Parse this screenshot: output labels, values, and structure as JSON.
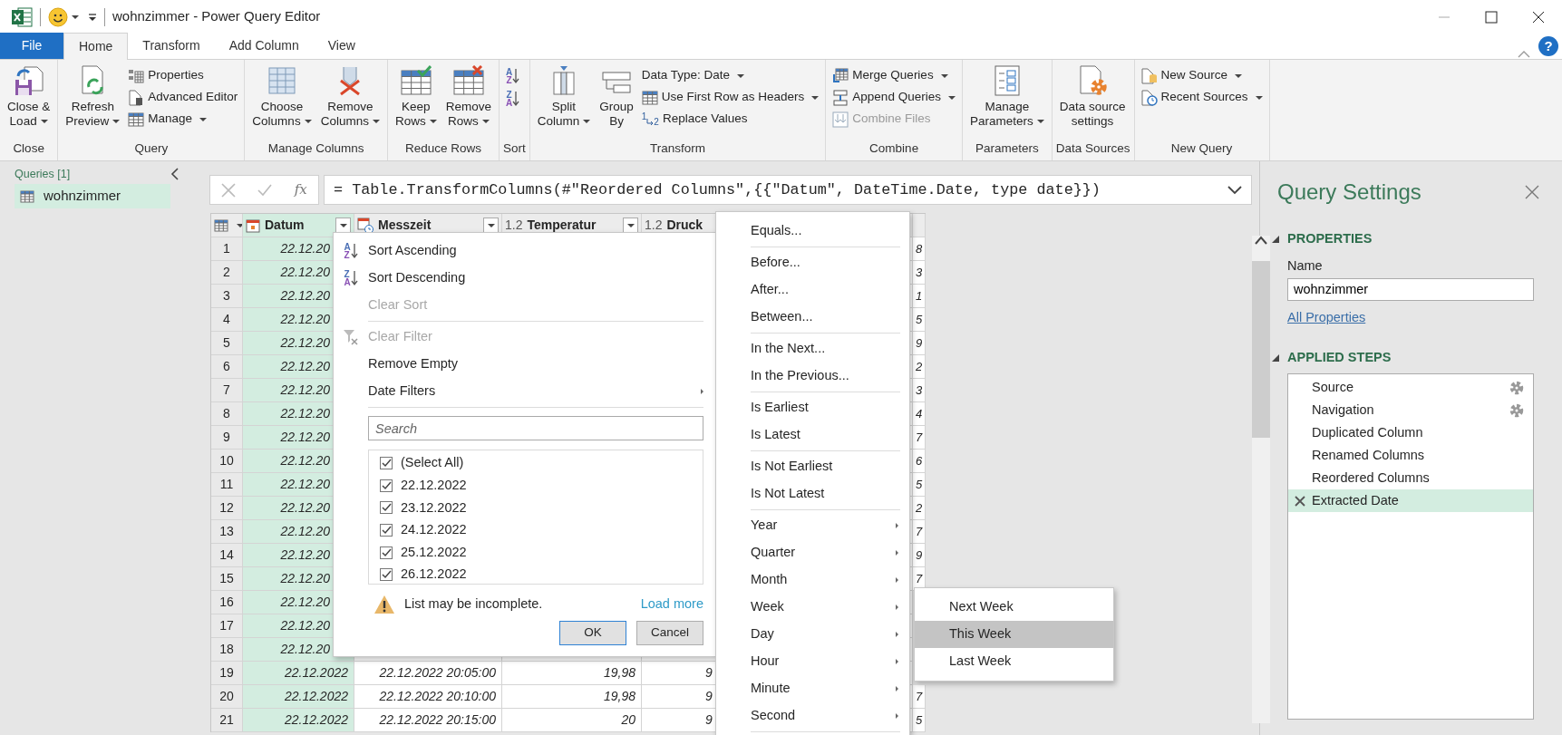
{
  "window": {
    "title": "wohnzimmer - Power Query Editor"
  },
  "help_label": "?",
  "ribbon_tabs": [
    {
      "label": "File",
      "kind": "file",
      "selected": false
    },
    {
      "label": "Home",
      "kind": "tab",
      "selected": true
    },
    {
      "label": "Transform",
      "kind": "tab",
      "selected": false
    },
    {
      "label": "Add Column",
      "kind": "tab",
      "selected": false
    },
    {
      "label": "View",
      "kind": "tab",
      "selected": false
    }
  ],
  "ribbon_groups": [
    {
      "label": "Close",
      "items": [
        {
          "kind": "large",
          "lines": [
            "Close &",
            "Load"
          ],
          "dropdown": true
        }
      ]
    },
    {
      "label": "Query",
      "items": [
        {
          "kind": "large",
          "lines": [
            "Refresh",
            "Preview"
          ],
          "dropdown": true
        },
        {
          "kind": "small",
          "label": "Properties"
        },
        {
          "kind": "small",
          "label": "Advanced Editor"
        },
        {
          "kind": "small",
          "label": "Manage",
          "dropdown": true
        }
      ]
    },
    {
      "label": "Manage Columns",
      "items": [
        {
          "kind": "large",
          "lines": [
            "Choose",
            "Columns"
          ],
          "dropdown": true
        },
        {
          "kind": "large",
          "lines": [
            "Remove",
            "Columns"
          ],
          "dropdown": true
        }
      ]
    },
    {
      "label": "Reduce Rows",
      "items": [
        {
          "kind": "large",
          "lines": [
            "Keep",
            "Rows"
          ],
          "dropdown": true
        },
        {
          "kind": "large",
          "lines": [
            "Remove",
            "Rows"
          ],
          "dropdown": true
        }
      ]
    },
    {
      "label": "Sort",
      "items": [
        {
          "kind": "sort",
          "glyphs": [
            "A",
            "Z"
          ]
        },
        {
          "kind": "sort",
          "glyphs": [
            "Z",
            "A"
          ]
        }
      ]
    },
    {
      "label": "Transform",
      "items": [
        {
          "kind": "large",
          "lines": [
            "Split",
            "Column"
          ],
          "dropdown": true
        },
        {
          "kind": "large",
          "lines": [
            "Group",
            "By"
          ]
        },
        {
          "kind": "small",
          "label": "Data Type: Date",
          "dropdown": true
        },
        {
          "kind": "small",
          "label": "Use First Row as Headers",
          "dropdown": true
        },
        {
          "kind": "small",
          "label": "Replace Values",
          "icon_text": [
            "1",
            "2"
          ]
        }
      ]
    },
    {
      "label": "Combine",
      "items": [
        {
          "kind": "small",
          "label": "Merge Queries",
          "dropdown": true
        },
        {
          "kind": "small",
          "label": "Append Queries",
          "dropdown": true
        },
        {
          "kind": "small",
          "label": "Combine Files",
          "disabled": true
        }
      ]
    },
    {
      "label": "Parameters",
      "items": [
        {
          "kind": "large",
          "lines": [
            "Manage",
            "Parameters"
          ],
          "dropdown": true
        }
      ]
    },
    {
      "label": "Data Sources",
      "items": [
        {
          "kind": "large",
          "lines": [
            "Data source",
            "settings"
          ]
        }
      ]
    },
    {
      "label": "New Query",
      "items": [
        {
          "kind": "small",
          "label": "New Source",
          "dropdown": true
        },
        {
          "kind": "small",
          "label": "Recent Sources",
          "dropdown": true
        }
      ]
    }
  ],
  "queries": {
    "heading": "Queries [1]",
    "items": [
      {
        "label": "wohnzimmer",
        "selected": true
      }
    ]
  },
  "formula_bar": {
    "fx_label": "fx",
    "formula": "= Table.TransformColumns(#\"Reordered Columns\",{{\"Datum\", DateTime.Date, type date}})"
  },
  "table": {
    "columns": [
      {
        "name": "Datum",
        "kind": "date",
        "selected": true,
        "filter_button": true
      },
      {
        "name": "Messzeit",
        "kind": "datetime",
        "selected": false,
        "filter_button": true
      },
      {
        "name": "Temperatur",
        "kind": "number",
        "type_label": "1.2",
        "selected": false,
        "filter_button": true
      },
      {
        "name": "Druck",
        "kind": "number",
        "type_label": "1.2",
        "selected": false
      }
    ],
    "rows": [
      {
        "index": "1",
        "datum": "22.12.20",
        "column_6": "8"
      },
      {
        "index": "2",
        "datum": "22.12.20",
        "column_6": "3"
      },
      {
        "index": "3",
        "datum": "22.12.20",
        "column_6": "1"
      },
      {
        "index": "4",
        "datum": "22.12.20",
        "column_6": "5"
      },
      {
        "index": "5",
        "datum": "22.12.20",
        "column_6": "9"
      },
      {
        "index": "6",
        "datum": "22.12.20",
        "column_6": "2"
      },
      {
        "index": "7",
        "datum": "22.12.20",
        "column_6": "3"
      },
      {
        "index": "8",
        "datum": "22.12.20",
        "column_6": "4"
      },
      {
        "index": "9",
        "datum": "22.12.20",
        "column_6": "7"
      },
      {
        "index": "10",
        "datum": "22.12.20",
        "column_6": "6"
      },
      {
        "index": "11",
        "datum": "22.12.20",
        "column_6": "5"
      },
      {
        "index": "12",
        "datum": "22.12.20",
        "column_6": "2"
      },
      {
        "index": "13",
        "datum": "22.12.20",
        "column_6": "7"
      },
      {
        "index": "14",
        "datum": "22.12.20",
        "column_6": "9"
      },
      {
        "index": "15",
        "datum": "22.12.20",
        "column_6": "7"
      },
      {
        "index": "16",
        "datum": "22.12.20"
      },
      {
        "index": "17",
        "datum": "22.12.20"
      },
      {
        "index": "18",
        "datum": "22.12.20"
      },
      {
        "index": "19",
        "datum": "22.12.2022",
        "messzeit": "22.12.2022 20:05:00",
        "temperatur": "19,98",
        "druck": "9"
      },
      {
        "index": "20",
        "datum": "22.12.2022",
        "messzeit": "22.12.2022 20:10:00",
        "temperatur": "19,98",
        "druck": "9",
        "column_6": "7"
      },
      {
        "index": "21",
        "datum": "22.12.2022",
        "messzeit": "22.12.2022 20:15:00",
        "temperatur": "20",
        "druck": "9",
        "column_6": "5"
      }
    ]
  },
  "filter_menu": {
    "items": [
      {
        "kind": "sort",
        "label": "Sort Ascending",
        "glyphs": [
          "A",
          "Z"
        ]
      },
      {
        "kind": "sort",
        "label": "Sort Descending",
        "glyphs": [
          "Z",
          "A"
        ]
      },
      {
        "kind": "plain",
        "label": "Clear Sort",
        "disabled": true
      },
      {
        "kind": "divider"
      },
      {
        "kind": "clear_filter",
        "label": "Clear Filter",
        "disabled": true
      },
      {
        "kind": "plain",
        "label": "Remove Empty"
      },
      {
        "kind": "plain",
        "label": "Date Filters",
        "submenu": true
      },
      {
        "kind": "divider"
      }
    ],
    "search": {
      "placeholder": "Search"
    },
    "values": [
      {
        "label": "(Select All)",
        "checked": true
      },
      {
        "label": "22.12.2022",
        "checked": true
      },
      {
        "label": "23.12.2022",
        "checked": true
      },
      {
        "label": "24.12.2022",
        "checked": true
      },
      {
        "label": "25.12.2022",
        "checked": true
      },
      {
        "label": "26.12.2022",
        "checked": true
      }
    ],
    "warning": "List may be incomplete.",
    "load_more": "Load more",
    "buttons": [
      {
        "label": "OK",
        "kind": "default"
      },
      {
        "label": "Cancel",
        "kind": "normal"
      }
    ]
  },
  "date_filter_menu": {
    "groups": [
      [
        {
          "label": "Equals..."
        }
      ],
      [
        {
          "label": "Before..."
        },
        {
          "label": "After..."
        },
        {
          "label": "Between..."
        }
      ],
      [
        {
          "label": "In the Next..."
        },
        {
          "label": "In the Previous..."
        }
      ],
      [
        {
          "label": "Is Earliest"
        },
        {
          "label": "Is Latest"
        }
      ],
      [
        {
          "label": "Is Not Earliest"
        },
        {
          "label": "Is Not Latest"
        }
      ],
      [
        {
          "label": "Year",
          "submenu": true
        },
        {
          "label": "Quarter",
          "submenu": true
        },
        {
          "label": "Month",
          "submenu": true
        },
        {
          "label": "Week",
          "submenu": true
        },
        {
          "label": "Day",
          "submenu": true
        },
        {
          "label": "Hour",
          "submenu": true
        },
        {
          "label": "Minute",
          "submenu": true
        },
        {
          "label": "Second",
          "submenu": true
        }
      ]
    ]
  },
  "week_submenu": {
    "items": [
      {
        "label": "Next Week",
        "selected": false
      },
      {
        "label": "This Week",
        "selected": true
      },
      {
        "label": "Last Week",
        "selected": false
      }
    ]
  },
  "query_settings": {
    "title": "Query Settings",
    "properties": {
      "heading": "PROPERTIES",
      "expanded": true,
      "name_label": "Name",
      "name_value": "wohnzimmer",
      "link": "All Properties"
    },
    "applied_steps": {
      "heading": "APPLIED STEPS",
      "expanded": true,
      "steps": [
        {
          "label": "Source",
          "settings": true,
          "selected": false
        },
        {
          "label": "Navigation",
          "settings": true,
          "selected": false
        },
        {
          "label": "Duplicated Column",
          "selected": false
        },
        {
          "label": "Renamed Columns",
          "selected": false
        },
        {
          "label": "Reordered Columns",
          "selected": false
        },
        {
          "label": "Extracted Date",
          "selected": true
        }
      ]
    }
  }
}
